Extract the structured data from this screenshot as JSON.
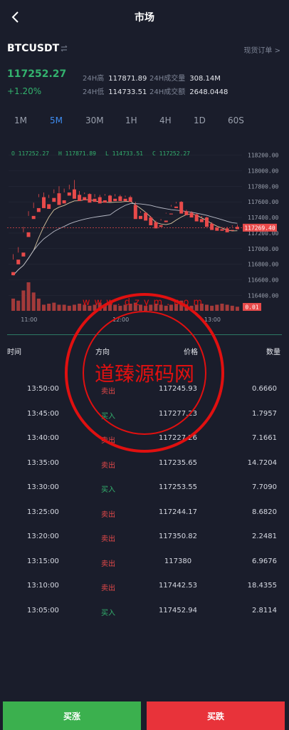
{
  "header": {
    "title": "市场"
  },
  "symbol": {
    "name": "BTCUSDT",
    "orders_link": "现货订单 >"
  },
  "ticker": {
    "price": "117252.27",
    "change": "+1.20%",
    "high_label": "24H高",
    "high": "117871.89",
    "vol_label": "24H成交量",
    "vol": "308.14M",
    "low_label": "24H低",
    "low": "114733.51",
    "amount_label": "24H成交额",
    "amount": "2648.0448"
  },
  "timeframes": [
    "1M",
    "5M",
    "30M",
    "1H",
    "4H",
    "1D",
    "60S"
  ],
  "active_timeframe": "5M",
  "chart_data": {
    "type": "candlestick",
    "ohlc_legend": {
      "o": "O 117252.27",
      "h": "H 117871.89",
      "l": "L 114733.51",
      "c": "C 117252.27"
    },
    "price_ticks": [
      "118200.00",
      "118000.00",
      "117800.00",
      "117600.00",
      "117400.00",
      "117200.00",
      "117000.00",
      "116800.00",
      "116600.00",
      "116400.00"
    ],
    "last_price_label": "117269.40",
    "volume_label": "0.01",
    "time_ticks": [
      "11:00",
      "12:00",
      "13:00"
    ],
    "ylim": [
      116350,
      118250
    ],
    "candles": [
      [
        116700,
        116930,
        116860,
        116660
      ],
      [
        116860,
        117020,
        116950,
        116800
      ],
      [
        116950,
        117280,
        117210,
        116900
      ],
      [
        117210,
        117480,
        117420,
        117150
      ],
      [
        117420,
        117590,
        117520,
        117380
      ],
      [
        117520,
        117700,
        117660,
        117470
      ],
      [
        117660,
        117720,
        117570,
        117520
      ],
      [
        117570,
        117690,
        117650,
        117510
      ],
      [
        117650,
        117760,
        117710,
        117600
      ],
      [
        117710,
        117800,
        117620,
        117560
      ],
      [
        117620,
        117770,
        117720,
        117580
      ],
      [
        117720,
        117820,
        117760,
        117680
      ],
      [
        117760,
        117880,
        117690,
        117640
      ],
      [
        117690,
        117740,
        117660,
        117610
      ],
      [
        117660,
        117720,
        117700,
        117620
      ],
      [
        117700,
        117710,
        117640,
        117590
      ],
      [
        117640,
        117700,
        117660,
        117600
      ],
      [
        117660,
        117690,
        117620,
        117580
      ],
      [
        117620,
        117700,
        117680,
        117590
      ],
      [
        117680,
        117690,
        117640,
        117600
      ],
      [
        117640,
        117700,
        117670,
        117610
      ],
      [
        117670,
        117690,
        117640,
        117610
      ],
      [
        117640,
        117680,
        117660,
        117610
      ],
      [
        117660,
        117680,
        117640,
        117600
      ],
      [
        117560,
        117600,
        117420,
        117380
      ],
      [
        117420,
        117480,
        117460,
        117380
      ],
      [
        117460,
        117470,
        117400,
        117360
      ],
      [
        117400,
        117420,
        117340,
        117300
      ],
      [
        117340,
        117360,
        117300,
        117260
      ],
      [
        117300,
        117380,
        117360,
        117280
      ],
      [
        117360,
        117460,
        117450,
        117340
      ],
      [
        117450,
        117560,
        117540,
        117440
      ],
      [
        117540,
        117600,
        117580,
        117520
      ],
      [
        117600,
        117610,
        117480,
        117450
      ],
      [
        117480,
        117500,
        117460,
        117430
      ],
      [
        117460,
        117480,
        117440,
        117400
      ],
      [
        117440,
        117450,
        117380,
        117350
      ],
      [
        117380,
        117420,
        117400,
        117340
      ],
      [
        117400,
        117410,
        117320,
        117280
      ],
      [
        117320,
        117340,
        117270,
        117240
      ],
      [
        117270,
        117290,
        117250,
        117230
      ],
      [
        117250,
        117280,
        117260,
        117230
      ],
      [
        117260,
        117280,
        117240,
        117210
      ],
      [
        117240,
        117300,
        117280,
        117230
      ],
      [
        117280,
        117310,
        117270,
        117250
      ]
    ],
    "volumes": [
      0.6,
      0.5,
      1.0,
      1.4,
      0.9,
      0.6,
      0.3,
      0.35,
      0.4,
      0.3,
      0.3,
      0.25,
      0.3,
      0.35,
      0.3,
      0.25,
      0.3,
      0.4,
      0.3,
      0.35,
      0.3,
      0.25,
      0.3,
      0.35,
      0.4,
      0.3,
      0.25,
      0.3,
      0.35,
      0.3,
      0.25,
      0.3,
      0.35,
      0.5,
      0.3,
      0.25,
      0.3,
      0.35,
      0.3,
      0.25,
      0.3,
      0.35,
      0.3,
      0.25,
      0.2
    ]
  },
  "trades": {
    "headers": {
      "time": "时间",
      "dir": "方向",
      "price": "价格",
      "qty": "数量"
    },
    "rows": [
      {
        "time": "13:50:00",
        "dir": "卖出",
        "side": "sell",
        "price": "117245.93",
        "qty": "0.6660"
      },
      {
        "time": "13:45:00",
        "dir": "买入",
        "side": "buy",
        "price": "117277.23",
        "qty": "1.7957"
      },
      {
        "time": "13:40:00",
        "dir": "卖出",
        "side": "sell",
        "price": "117227.26",
        "qty": "7.1661"
      },
      {
        "time": "13:35:00",
        "dir": "卖出",
        "side": "sell",
        "price": "117235.65",
        "qty": "14.7204"
      },
      {
        "time": "13:30:00",
        "dir": "买入",
        "side": "buy",
        "price": "117253.55",
        "qty": "7.7090"
      },
      {
        "time": "13:25:00",
        "dir": "卖出",
        "side": "sell",
        "price": "117244.17",
        "qty": "8.6820"
      },
      {
        "time": "13:20:00",
        "dir": "卖出",
        "side": "sell",
        "price": "117350.82",
        "qty": "2.2481"
      },
      {
        "time": "13:15:00",
        "dir": "卖出",
        "side": "sell",
        "price": "117380",
        "qty": "6.9676"
      },
      {
        "time": "13:10:00",
        "dir": "卖出",
        "side": "sell",
        "price": "117442.53",
        "qty": "18.4355"
      },
      {
        "time": "13:05:00",
        "dir": "买入",
        "side": "buy",
        "price": "117452.94",
        "qty": "2.8114"
      }
    ]
  },
  "watermark": {
    "text": "道臻源码网",
    "url": "www.dzym.com"
  },
  "actions": {
    "buy": "买涨",
    "sell": "买跌"
  },
  "colors": {
    "up": "#33b26e",
    "down": "#e84a4a",
    "accent": "#3e8cf0",
    "bg": "#1a1d2b"
  }
}
